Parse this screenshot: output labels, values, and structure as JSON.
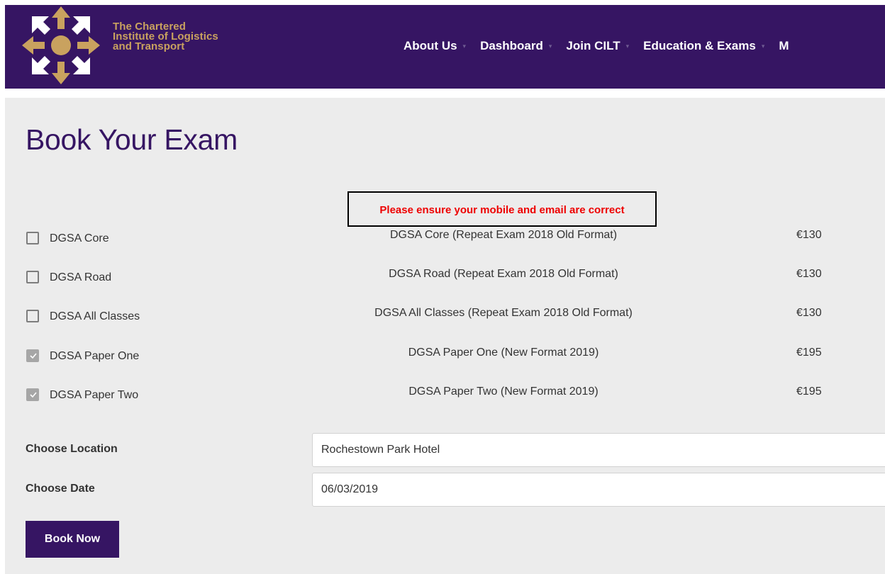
{
  "header": {
    "logo": {
      "line1": "The Chartered",
      "line2": "Institute of Logistics",
      "line3": "and Transport",
      "icon": "cilt-arrows-logo-icon",
      "color": "#c9a25f"
    },
    "nav": [
      {
        "label": "About Us"
      },
      {
        "label": "Dashboard"
      },
      {
        "label": "Join CILT"
      },
      {
        "label": "Education & Exams"
      },
      {
        "label": "M"
      }
    ],
    "background": "#361563"
  },
  "main": {
    "title": "Book Your Exam",
    "alert": "Please ensure your mobile and email are correct",
    "exams": [
      {
        "name": "DGSA Core",
        "description": "DGSA Core (Repeat Exam 2018 Old Format)",
        "price": "€130",
        "checked": false
      },
      {
        "name": "DGSA Road",
        "description": "DGSA Road (Repeat Exam 2018 Old Format)",
        "price": "€130",
        "checked": false
      },
      {
        "name": "DGSA All Classes",
        "description": "DGSA All Classes (Repeat Exam 2018 Old Format)",
        "price": "€130",
        "checked": false
      },
      {
        "name": "DGSA Paper One",
        "description": "DGSA Paper One (New Format 2019)",
        "price": "€195",
        "checked": true
      },
      {
        "name": "DGSA Paper Two",
        "description": "DGSA Paper Two (New Format 2019)",
        "price": "€195",
        "checked": true
      }
    ],
    "location": {
      "label": "Choose Location",
      "value": "Rochestown Park Hotel"
    },
    "date": {
      "label": "Choose Date",
      "value": "06/03/2019"
    },
    "book_button": "Book Now"
  },
  "colors": {
    "brand_purple": "#361563",
    "gold": "#c9a25f",
    "alert_red": "#ee0000",
    "content_bg": "#ececec"
  }
}
